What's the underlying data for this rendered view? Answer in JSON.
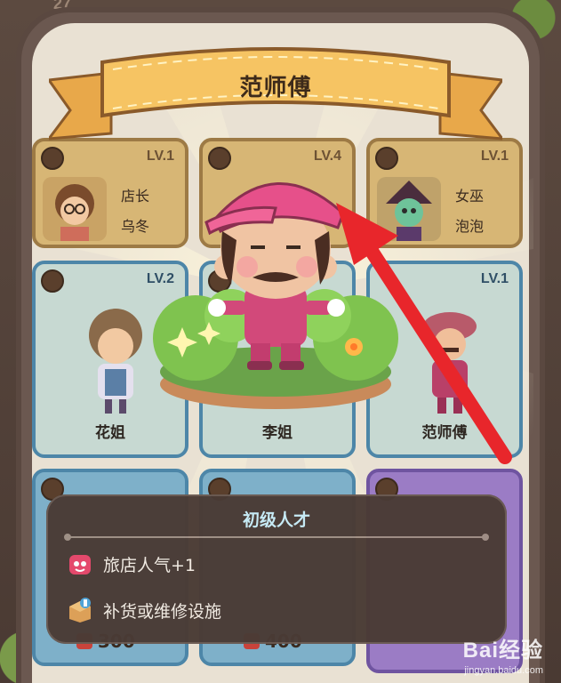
{
  "top_counter": "27",
  "banner": {
    "title": "范师傅"
  },
  "cards_top": [
    {
      "level": "LV.1",
      "role": "店长",
      "name": "乌冬"
    },
    {
      "level": "LV.4",
      "role": "",
      "name": ""
    },
    {
      "level": "LV.1",
      "role": "女巫",
      "name": "泡泡"
    }
  ],
  "cards_mid": [
    {
      "level": "LV.2",
      "name": "花姐"
    },
    {
      "level": "",
      "name": "李姐"
    },
    {
      "level": "LV.1",
      "name": "范师傅"
    }
  ],
  "cards_bottom": [
    {
      "cost": "300"
    },
    {
      "cost": "400"
    },
    {
      "cost": ""
    }
  ],
  "tooltip": {
    "title": "初级人才",
    "effects": [
      {
        "icon": "popularity-icon",
        "text": "旅店人气+1"
      },
      {
        "icon": "repair-box-icon",
        "text": "补货或维修设施"
      }
    ]
  },
  "watermark": {
    "logo": "Bai经验",
    "url": "jingyan.baidu.com"
  },
  "colors": {
    "arrow": "#e8262b",
    "tooltip_title": "#c9ecf7",
    "ribbon": "#f6c463"
  }
}
